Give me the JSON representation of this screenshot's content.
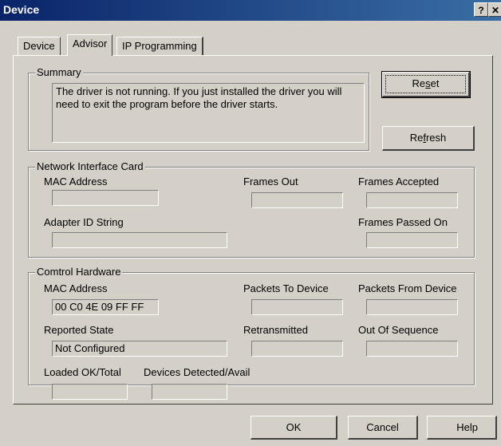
{
  "window": {
    "title": "Device",
    "help_glyph": "?",
    "close_glyph": "✕"
  },
  "tabs": [
    {
      "label": "Device",
      "active": false
    },
    {
      "label": "Advisor",
      "active": true
    },
    {
      "label": "IP Programming",
      "active": false
    }
  ],
  "summary": {
    "title": "Summary",
    "message": "The driver is not running.  If you just installed the driver you will need to exit the program before the driver starts."
  },
  "buttons": {
    "reset": {
      "pre": "Re",
      "accel": "s",
      "post": "et"
    },
    "refresh": {
      "pre": "Re",
      "accel": "f",
      "post": "resh"
    },
    "ok": "OK",
    "cancel": "Cancel",
    "help": "Help"
  },
  "nic": {
    "title": "Network Interface Card",
    "mac_label": "MAC Address",
    "mac_value": "",
    "frames_out_label": "Frames Out",
    "frames_accepted_label": "Frames Accepted",
    "adapter_label": "Adapter ID String",
    "frames_passed_label": "Frames Passed On"
  },
  "hw": {
    "title": "Comtrol Hardware",
    "mac_label": "MAC Address",
    "mac_value": "00 C0 4E 09 FF FF",
    "packets_to_label": "Packets To Device",
    "packets_from_label": "Packets From Device",
    "state_label": "Reported State",
    "state_value": "Not Configured",
    "retransmitted_label": "Retransmitted",
    "out_of_seq_label": "Out Of Sequence",
    "loaded_label": "Loaded OK/Total",
    "devices_label": "Devices Detected/Avail"
  }
}
